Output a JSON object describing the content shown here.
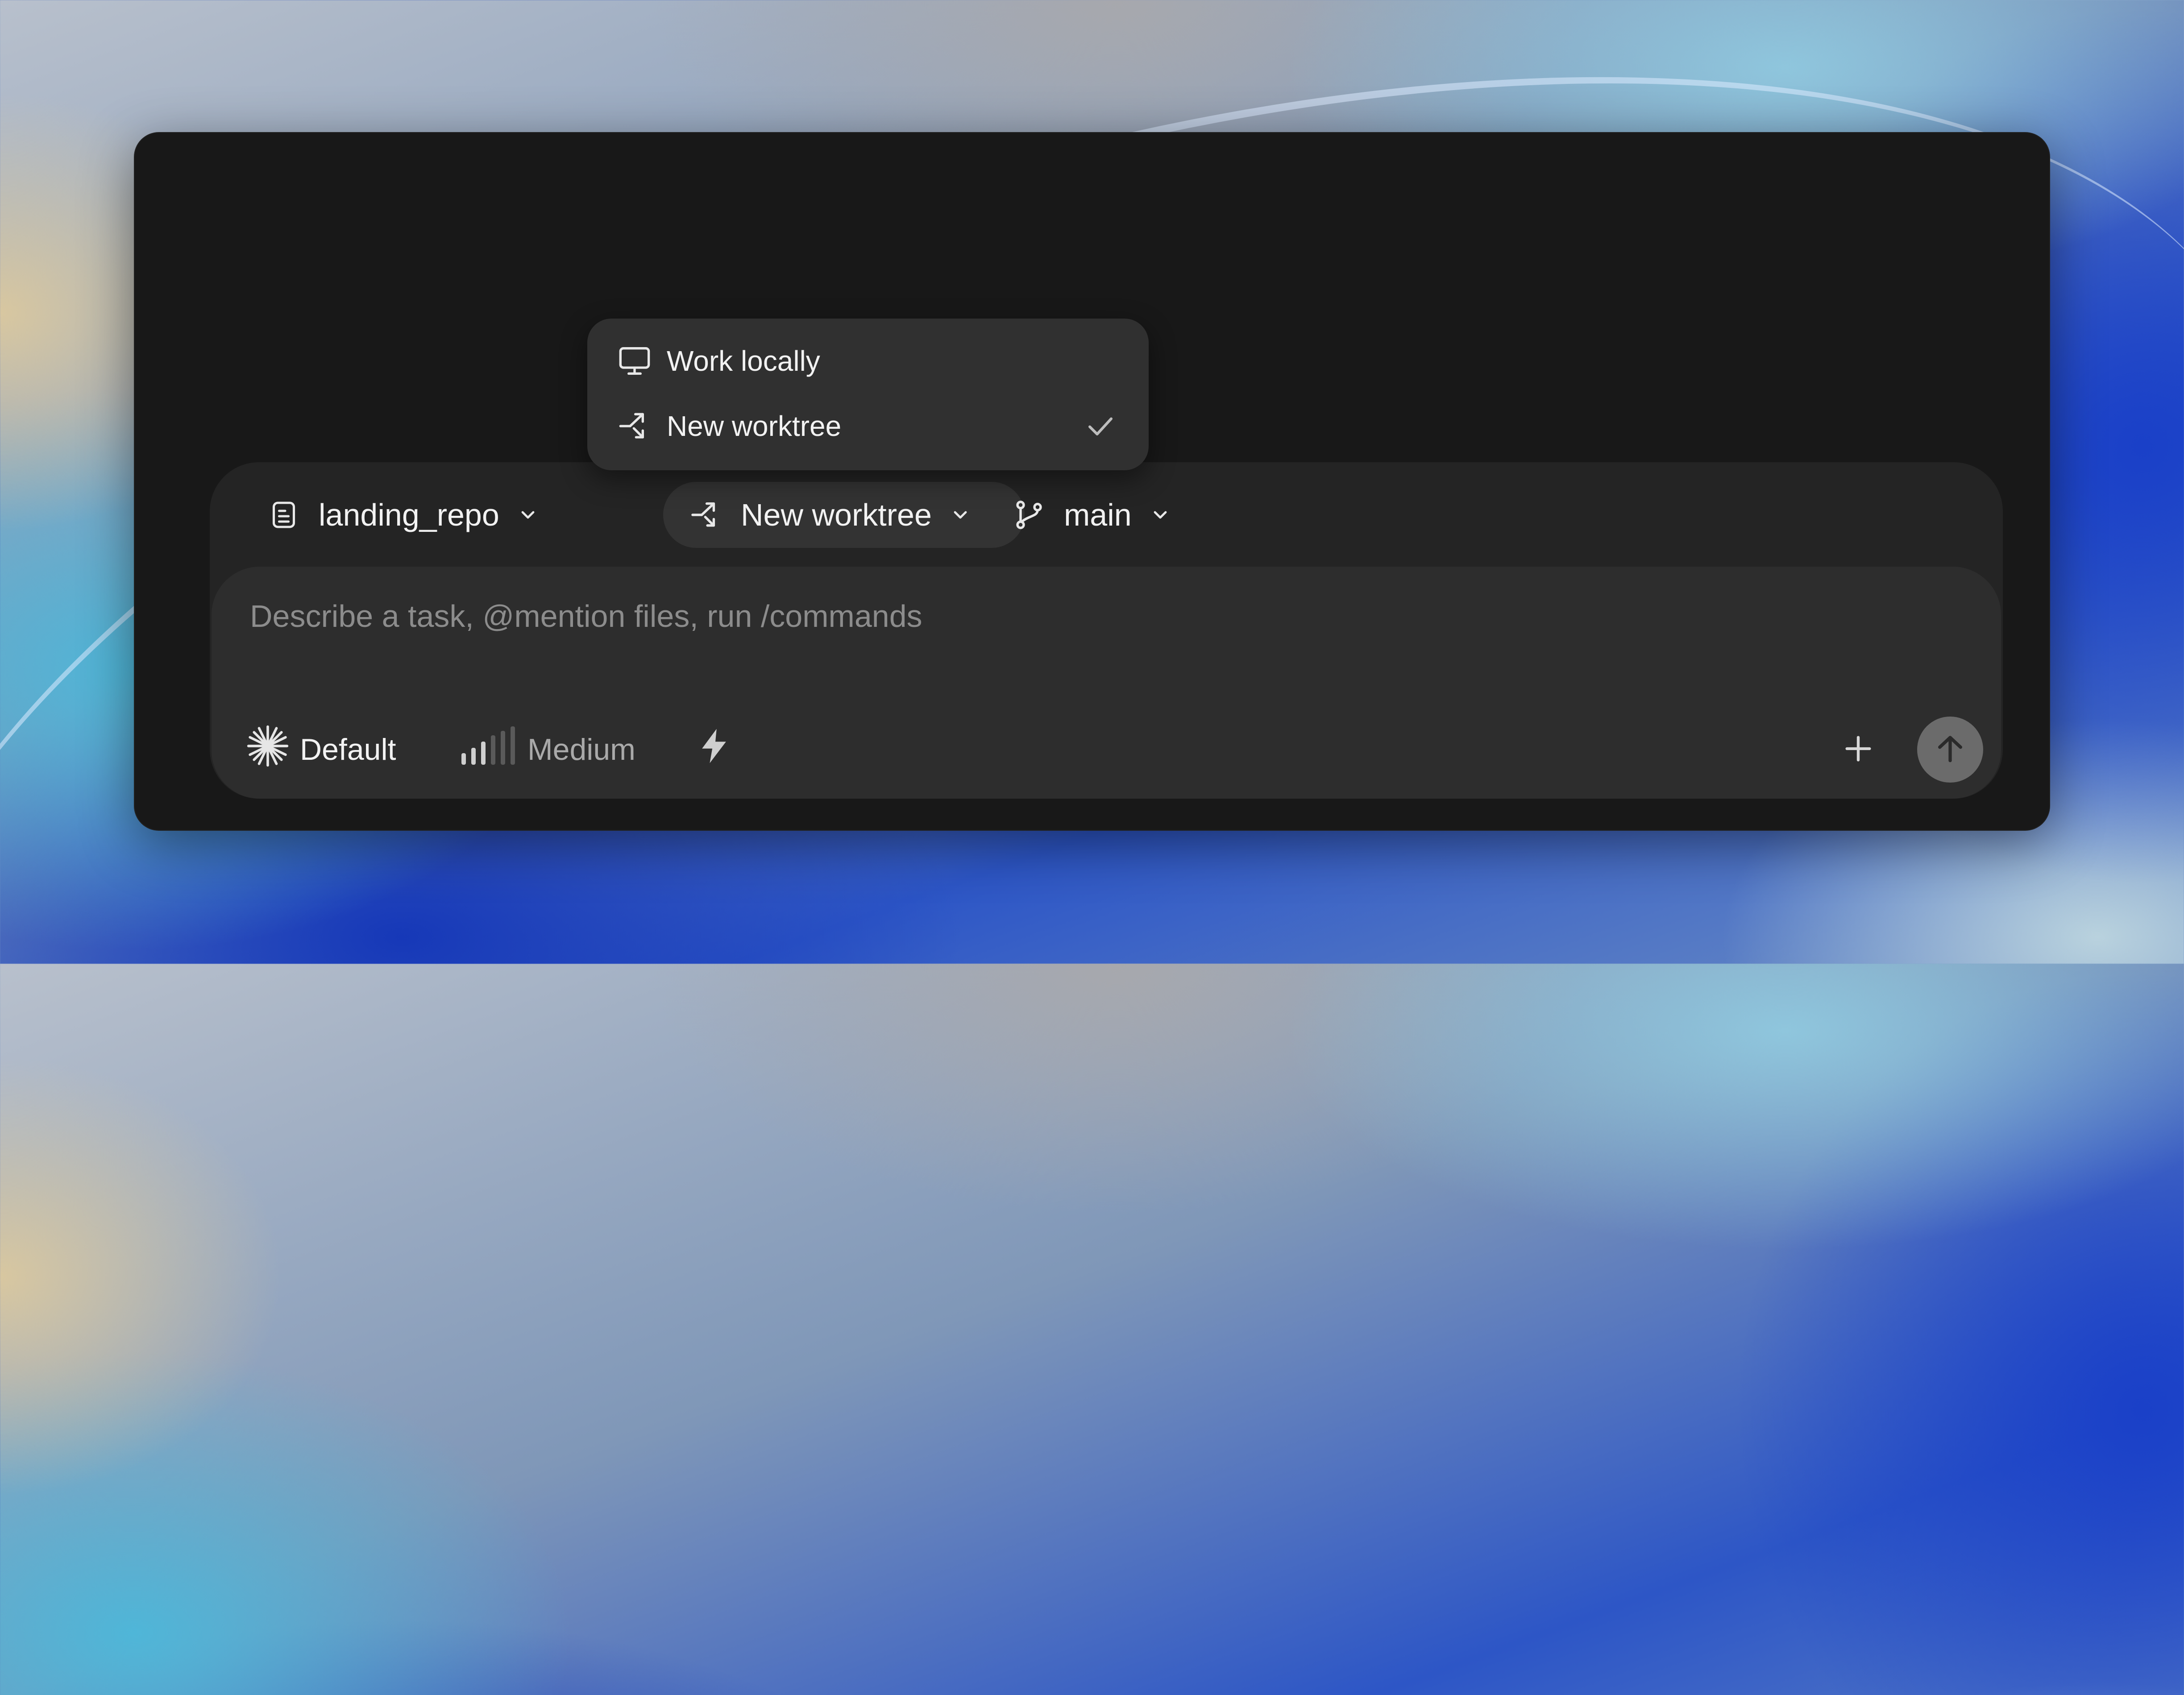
{
  "composer": {
    "repo": {
      "label": "landing_repo",
      "icon": "repo-icon"
    },
    "workspace": {
      "label": "New worktree",
      "icon": "worktree-icon"
    },
    "branch": {
      "label": "main",
      "icon": "branch-icon"
    },
    "input": {
      "placeholder": "Describe a task, @mention files, run /commands",
      "value": ""
    },
    "model": {
      "label": "Default",
      "icon": "sparkle-icon"
    },
    "effort": {
      "label": "Medium",
      "icon": "signal-bars-icon"
    },
    "fast_mode_icon": "bolt-icon",
    "add_icon": "plus-icon",
    "send_icon": "arrow-up-icon"
  },
  "workspace_menu": {
    "items": [
      {
        "label": "Work locally",
        "icon": "monitor-icon",
        "selected": false
      },
      {
        "label": "New worktree",
        "icon": "worktree-icon",
        "selected": true
      }
    ]
  },
  "colors": {
    "window_bg": "#181818",
    "card_bg": "#242424",
    "input_bg": "#2d2d2d",
    "menu_bg": "#303030",
    "send_bg": "#6b6b6b",
    "text": "#f2f2f2",
    "muted_text": "#8c8c8c"
  }
}
